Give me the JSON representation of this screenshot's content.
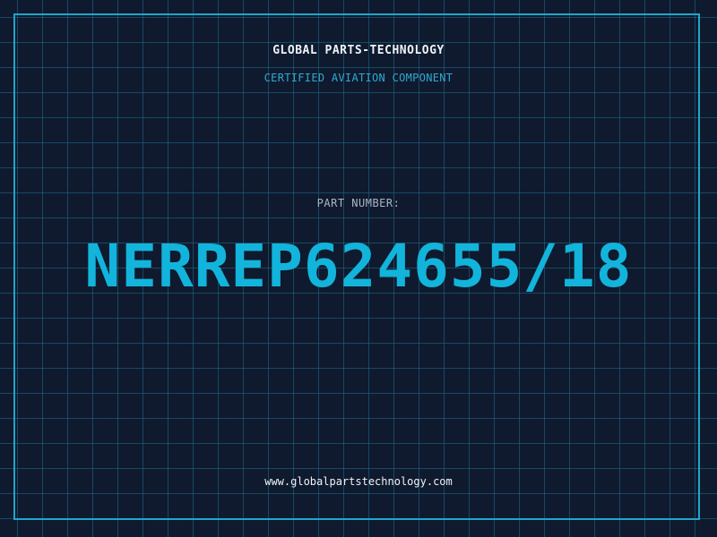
{
  "header": {
    "company": "GLOBAL PARTS-TECHNOLOGY",
    "subtitle": "CERTIFIED AVIATION COMPONENT"
  },
  "part": {
    "label": "PART NUMBER:",
    "number": "NERREP624655/18"
  },
  "footer": {
    "website": "www.globalpartstechnology.com"
  },
  "colors": {
    "background": "#0f1a2e",
    "grid": "#1e6e8c",
    "frame": "#1fa6c9",
    "accent": "#12b4db",
    "text": "#eef3f8"
  }
}
